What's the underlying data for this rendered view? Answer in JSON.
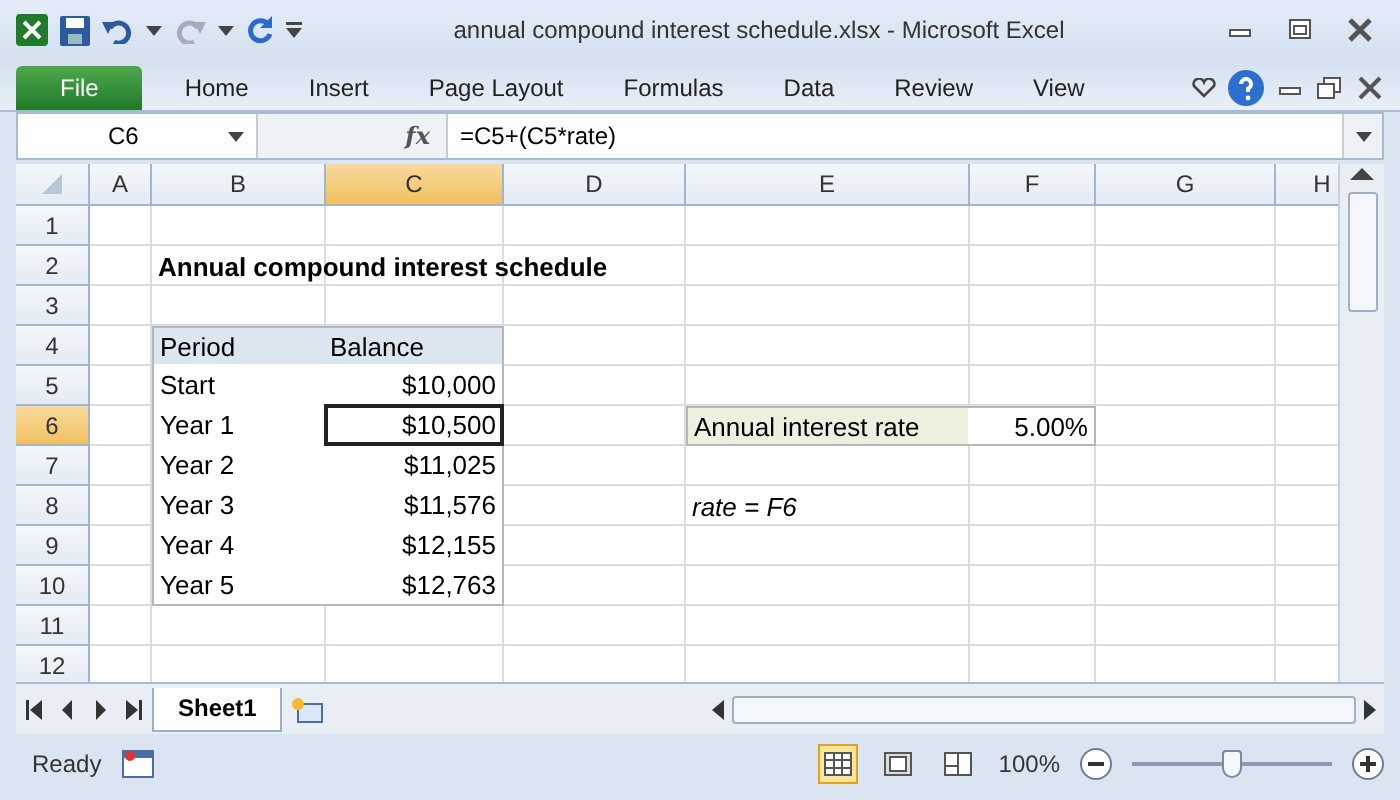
{
  "window": {
    "title": "annual compound interest schedule.xlsx  -  Microsoft Excel"
  },
  "ribbon_tabs": [
    {
      "label": "File",
      "kind": "file"
    },
    {
      "label": "Home",
      "kind": "tab"
    },
    {
      "label": "Insert",
      "kind": "tab"
    },
    {
      "label": "Page Layout",
      "kind": "tab"
    },
    {
      "label": "Formulas",
      "kind": "tab"
    },
    {
      "label": "Data",
      "kind": "tab"
    },
    {
      "label": "Review",
      "kind": "tab"
    },
    {
      "label": "View",
      "kind": "tab"
    }
  ],
  "formula_bar": {
    "name_box": "C6",
    "function_label": "fx",
    "formula": "=C5+(C5*rate)"
  },
  "columns": [
    {
      "label": "A",
      "selected": false
    },
    {
      "label": "B",
      "selected": false
    },
    {
      "label": "C",
      "selected": true
    },
    {
      "label": "D",
      "selected": false
    },
    {
      "label": "E",
      "selected": false
    },
    {
      "label": "F",
      "selected": false
    },
    {
      "label": "G",
      "selected": false
    },
    {
      "label": "H",
      "selected": false
    }
  ],
  "rows": [
    {
      "label": "1",
      "selected": false
    },
    {
      "label": "2",
      "selected": false
    },
    {
      "label": "3",
      "selected": false
    },
    {
      "label": "4",
      "selected": false
    },
    {
      "label": "5",
      "selected": false
    },
    {
      "label": "6",
      "selected": true
    },
    {
      "label": "7",
      "selected": false
    },
    {
      "label": "8",
      "selected": false
    },
    {
      "label": "9",
      "selected": false
    },
    {
      "label": "10",
      "selected": false
    },
    {
      "label": "11",
      "selected": false
    },
    {
      "label": "12",
      "selected": false
    }
  ],
  "sheet": {
    "title": "Annual compound interest schedule",
    "table": {
      "columns": [
        "Period",
        "Balance"
      ],
      "rows": [
        {
          "period": "Start",
          "balance": "$10,000",
          "active": false
        },
        {
          "period": "Year 1",
          "balance": "$10,500",
          "active": true
        },
        {
          "period": "Year 2",
          "balance": "$11,025",
          "active": false
        },
        {
          "period": "Year 3",
          "balance": "$11,576",
          "active": false
        },
        {
          "period": "Year 4",
          "balance": "$12,155",
          "active": false
        },
        {
          "period": "Year 5",
          "balance": "$12,763",
          "active": false
        }
      ]
    },
    "rate": {
      "label": "Annual interest rate",
      "value": "5.00%"
    },
    "note": "rate = F6"
  },
  "sheet_tabs": [
    {
      "label": "Sheet1",
      "selected": true
    }
  ],
  "status_bar": {
    "status": "Ready",
    "views": [
      {
        "kind": "normal",
        "selected": true
      },
      {
        "kind": "page_layout",
        "selected": false
      },
      {
        "kind": "page_break",
        "selected": false
      }
    ],
    "zoom": "100%",
    "zoom_slider": {
      "level": 0.5
    }
  }
}
